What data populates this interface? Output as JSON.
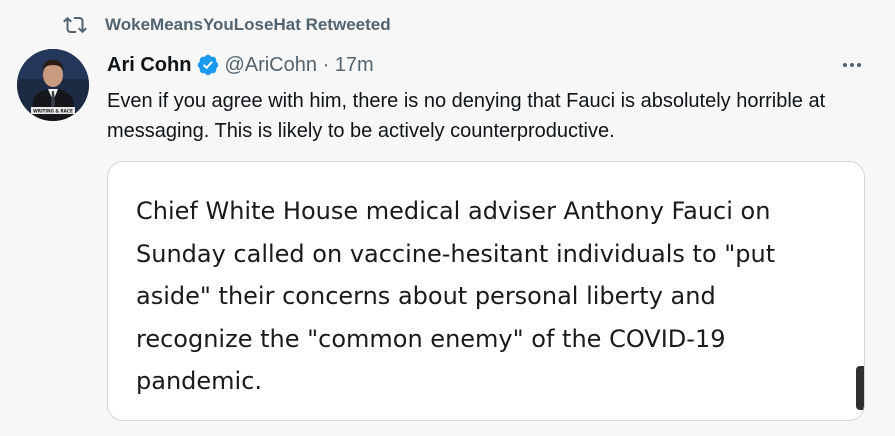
{
  "retweet": {
    "icon": "retweet-icon",
    "label": "WokeMeansYouLoseHat Retweeted"
  },
  "tweet": {
    "author_name": "Ari Cohn",
    "verified_icon": "verified-badge-icon",
    "handle": "@AriCohn",
    "separator": "·",
    "time": "17m",
    "text": "Even if you agree with him, there is no denying that Fauci is absolutely horrible at messaging. This is likely to be actively counterproductive.",
    "more_icon": "more-options-icon",
    "avatar_caption": "WRITING & RACE"
  },
  "card": {
    "text": "Chief White House medical adviser Anthony Fauci on Sunday called on vaccine-hesitant individuals to \"put aside\" their concerns about personal liberty and recognize the \"common enemy\" of the COVID-19 pandemic."
  },
  "colors": {
    "background": "#f7f7f7",
    "secondary_text": "#536471",
    "primary_text": "#0f1419",
    "verified_blue": "#1d9bf0",
    "card_border": "#cfd9de"
  }
}
